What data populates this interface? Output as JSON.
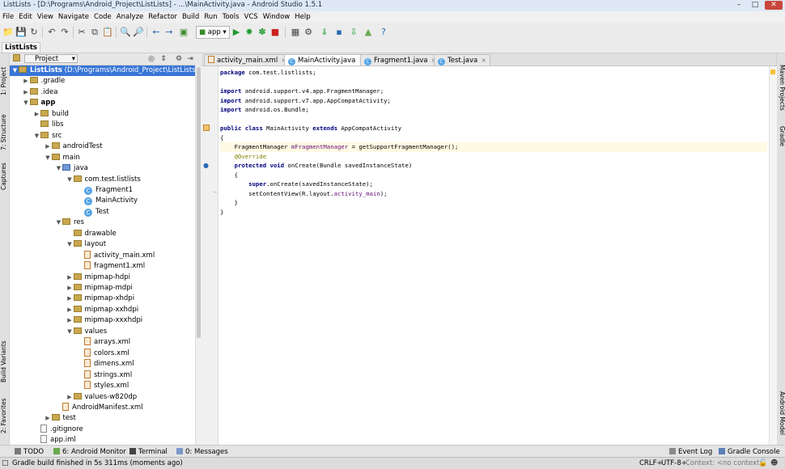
{
  "window": {
    "title": "ListLists - [D:\\Programs\\Android_Project\\ListLists] - ...\\MainActivity.java - Android Studio 1.5.1",
    "minimize": "–",
    "maximize": "□",
    "close": "✕"
  },
  "menu": [
    "File",
    "Edit",
    "View",
    "Navigate",
    "Code",
    "Analyze",
    "Refactor",
    "Build",
    "Run",
    "Tools",
    "VCS",
    "Window",
    "Help"
  ],
  "toolbar": {
    "run_config": "app"
  },
  "nav": {
    "breadcrumb": "ListLists"
  },
  "left_strip": {
    "project": "1: Project",
    "structure": "7: Structure",
    "captures": "Captures",
    "build_variants": "Build Variants",
    "favorites": "2: Favorites"
  },
  "right_strip": {
    "maven": "Maven Projects",
    "gradle": "Gradle",
    "android_model": "Android Model"
  },
  "project_panel": {
    "view_mode": "Project"
  },
  "tree": [
    {
      "label": "ListLists",
      "suffix": " (D:\\Programs\\Android_Project\\ListLists)",
      "depth": 0,
      "arrow": "down",
      "icon": "folder",
      "selected": true
    },
    {
      "label": ".gradle",
      "depth": 1,
      "arrow": "right",
      "icon": "folder"
    },
    {
      "label": ".idea",
      "depth": 1,
      "arrow": "right",
      "icon": "folder"
    },
    {
      "label": "app",
      "depth": 1,
      "arrow": "down",
      "icon": "folder",
      "bold": true
    },
    {
      "label": "build",
      "depth": 2,
      "arrow": "right",
      "icon": "folder"
    },
    {
      "label": "libs",
      "depth": 2,
      "arrow": "",
      "icon": "folder"
    },
    {
      "label": "src",
      "depth": 2,
      "arrow": "down",
      "icon": "folder"
    },
    {
      "label": "androidTest",
      "depth": 3,
      "arrow": "right",
      "icon": "folder"
    },
    {
      "label": "main",
      "depth": 3,
      "arrow": "down",
      "icon": "folder"
    },
    {
      "label": "java",
      "depth": 4,
      "arrow": "down",
      "icon": "folder-blue"
    },
    {
      "label": "com.test.listlists",
      "depth": 5,
      "arrow": "down",
      "icon": "folder"
    },
    {
      "label": "Fragment1",
      "depth": 6,
      "arrow": "",
      "icon": "class"
    },
    {
      "label": "MainActivity",
      "depth": 6,
      "arrow": "",
      "icon": "class"
    },
    {
      "label": "Test",
      "depth": 6,
      "arrow": "",
      "icon": "class"
    },
    {
      "label": "res",
      "depth": 4,
      "arrow": "down",
      "icon": "folder"
    },
    {
      "label": "drawable",
      "depth": 5,
      "arrow": "",
      "icon": "folder"
    },
    {
      "label": "layout",
      "depth": 5,
      "arrow": "down",
      "icon": "folder"
    },
    {
      "label": "activity_main.xml",
      "depth": 6,
      "arrow": "",
      "icon": "xml"
    },
    {
      "label": "fragment1.xml",
      "depth": 6,
      "arrow": "",
      "icon": "xml"
    },
    {
      "label": "mipmap-hdpi",
      "depth": 5,
      "arrow": "right",
      "icon": "folder"
    },
    {
      "label": "mipmap-mdpi",
      "depth": 5,
      "arrow": "right",
      "icon": "folder"
    },
    {
      "label": "mipmap-xhdpi",
      "depth": 5,
      "arrow": "right",
      "icon": "folder"
    },
    {
      "label": "mipmap-xxhdpi",
      "depth": 5,
      "arrow": "right",
      "icon": "folder"
    },
    {
      "label": "mipmap-xxxhdpi",
      "depth": 5,
      "arrow": "right",
      "icon": "folder"
    },
    {
      "label": "values",
      "depth": 5,
      "arrow": "down",
      "icon": "folder"
    },
    {
      "label": "arrays.xml",
      "depth": 6,
      "arrow": "",
      "icon": "xml"
    },
    {
      "label": "colors.xml",
      "depth": 6,
      "arrow": "",
      "icon": "xml"
    },
    {
      "label": "dimens.xml",
      "depth": 6,
      "arrow": "",
      "icon": "xml"
    },
    {
      "label": "strings.xml",
      "depth": 6,
      "arrow": "",
      "icon": "xml"
    },
    {
      "label": "styles.xml",
      "depth": 6,
      "arrow": "",
      "icon": "xml"
    },
    {
      "label": "values-w820dp",
      "depth": 5,
      "arrow": "right",
      "icon": "folder"
    },
    {
      "label": "AndroidManifest.xml",
      "depth": 4,
      "arrow": "",
      "icon": "xml"
    },
    {
      "label": "test",
      "depth": 3,
      "arrow": "right",
      "icon": "folder"
    },
    {
      "label": ".gitignore",
      "depth": 2,
      "arrow": "",
      "icon": "file"
    },
    {
      "label": "app.iml",
      "depth": 2,
      "arrow": "",
      "icon": "file"
    }
  ],
  "editor_tabs": [
    {
      "label": "activity_main.xml",
      "icon": "xml",
      "active": false
    },
    {
      "label": "MainActivity.java",
      "icon": "class",
      "active": true
    },
    {
      "label": "Fragment1.java",
      "icon": "class",
      "active": false
    },
    {
      "label": "Test.java",
      "icon": "class",
      "active": false
    }
  ],
  "code": {
    "l1": {
      "kw": "package",
      "rest": " com.test.listlists;"
    },
    "l3": {
      "kw": "import",
      "rest": " android.support.v4.app.FragmentManager;"
    },
    "l4": {
      "kw": "import",
      "rest": " android.support.v7.app.AppCompatActivity;"
    },
    "l5": {
      "kw": "import",
      "rest": " android.os.Bundle;"
    },
    "l7": {
      "kw": "public class",
      "name": " MainActivity ",
      "kw2": "extends",
      "rest": " AppCompatActivity"
    },
    "l8": "{",
    "l9": {
      "type": "    FragmentManager ",
      "field": "mFragmentManager",
      "rest": " = getSupportFragmentManager();"
    },
    "l10": "    @Override",
    "l11": {
      "kw": "    protected void",
      "rest": " onCreate(Bundle savedInstanceState)"
    },
    "l12": "    {",
    "l13": {
      "kw": "        super",
      "rest": ".onCreate(savedInstanceState);"
    },
    "l14": {
      "pre": "        setContentView(R.layout.",
      "field": "activity_main",
      "rest": ");"
    },
    "l15": "    }",
    "l16": "}"
  },
  "bottom_tabs": {
    "todo": "TODO",
    "android_monitor": "6: Android Monitor",
    "terminal": "Terminal",
    "messages": "0: Messages",
    "event_log": "Event Log",
    "gradle_console": "Gradle Console"
  },
  "status": {
    "message": "Gradle build finished in 5s 311ms (moments ago)",
    "line_sep": "CRLF÷",
    "encoding": "UTF-8÷",
    "context": "Context: <no context>"
  },
  "colors": {
    "selection": "#3875d7",
    "keyword": "#000080",
    "field": "#660e7a",
    "annotation": "#808000"
  }
}
